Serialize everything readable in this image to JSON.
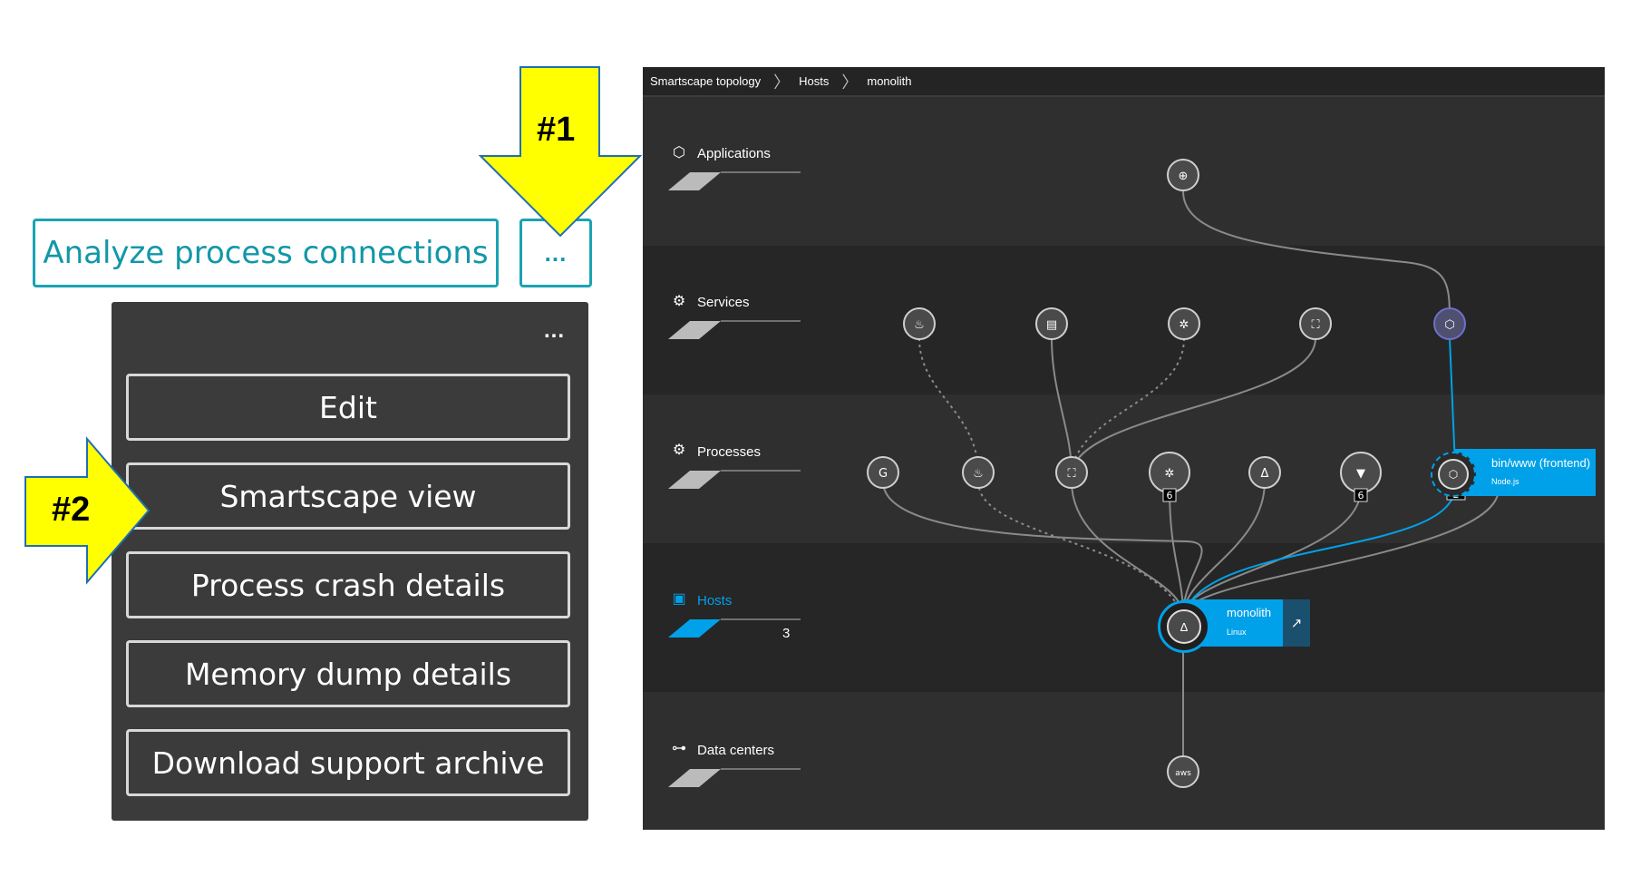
{
  "left_panel": {
    "analyze_label": "Analyze process connections",
    "more_label": "...",
    "menu_dots": "...",
    "menu_items": [
      "Edit",
      "Smartscape view",
      "Process crash details",
      "Memory dump details",
      "Download support archive"
    ],
    "callout_1": "#1",
    "callout_2": "#2",
    "callout_color": "#ffff00"
  },
  "smartscape": {
    "breadcrumbs": [
      "Smartscape topology",
      "Hosts",
      "monolith"
    ],
    "layers": {
      "applications": "Applications",
      "services": "Services",
      "processes": "Processes",
      "hosts": "Hosts",
      "hosts_count": "3",
      "datacenters": "Data centers"
    },
    "process_badges": [
      "6",
      "6",
      "2"
    ],
    "selected_process": {
      "name": "bin/www (frontend)",
      "tech": "Node.js"
    },
    "host": {
      "name": "monolith",
      "os": "Linux"
    },
    "datacenter_icon_text": "aws",
    "colors": {
      "accent": "#00a1e8",
      "background": "#2d2d2d",
      "band_dark": "#262626"
    }
  }
}
